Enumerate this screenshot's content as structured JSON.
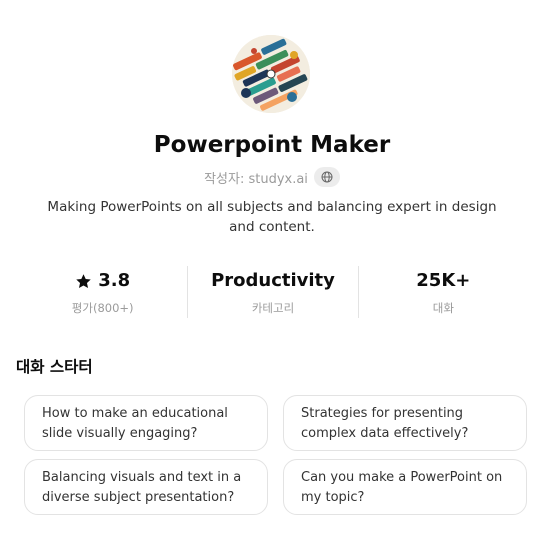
{
  "gpt": {
    "name": "Powerpoint Maker",
    "author": "작성자: studyx.ai",
    "description": "Making PowerPoints on all subjects and balancing expert in design and content."
  },
  "stats": [
    {
      "value": "3.8",
      "label": "평가(800+)",
      "icon": "star-icon"
    },
    {
      "value": "Productivity",
      "label": "카테고리"
    },
    {
      "value": "25K+",
      "label": "대화"
    }
  ],
  "starters": {
    "title": "대화 스타터",
    "items": [
      "How to make an educational slide visually engaging?",
      "Strategies for presenting complex data effectively?",
      "Balancing visuals and text in a diverse subject presentation?",
      "Can you make a PowerPoint on my topic?"
    ]
  },
  "colors": {
    "text": "#0d0d0d",
    "muted": "#9b9b9b",
    "border": "#e3e3e3",
    "badge": "#ececec"
  }
}
